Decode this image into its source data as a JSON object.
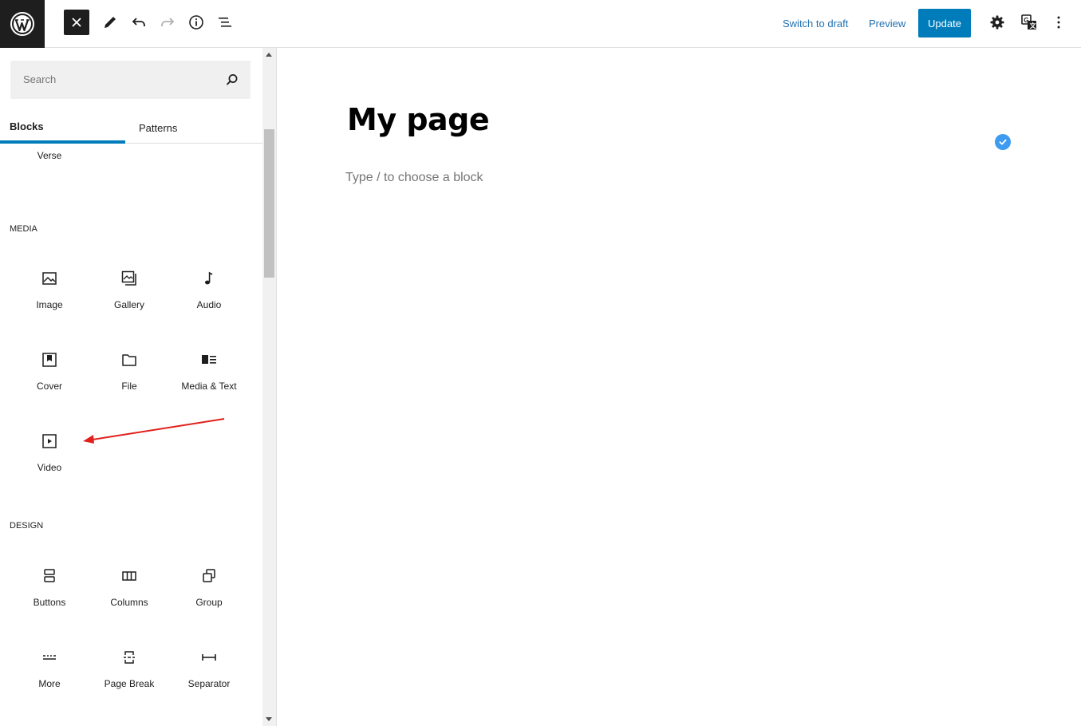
{
  "header": {
    "switch_to_draft": "Switch to draft",
    "preview": "Preview",
    "update": "Update"
  },
  "inserter": {
    "search_placeholder": "Search",
    "tabs": [
      {
        "label": "Blocks",
        "active": true
      },
      {
        "label": "Patterns",
        "active": false
      }
    ],
    "partial_block": {
      "label": "Verse",
      "icon": "verse-icon"
    },
    "sections": [
      {
        "title": "MEDIA",
        "blocks": [
          {
            "label": "Image",
            "icon": "image-icon"
          },
          {
            "label": "Gallery",
            "icon": "gallery-icon"
          },
          {
            "label": "Audio",
            "icon": "audio-icon"
          },
          {
            "label": "Cover",
            "icon": "cover-icon"
          },
          {
            "label": "File",
            "icon": "file-icon"
          },
          {
            "label": "Media & Text",
            "icon": "media-text-icon"
          },
          {
            "label": "Video",
            "icon": "video-icon"
          }
        ]
      },
      {
        "title": "DESIGN",
        "blocks": [
          {
            "label": "Buttons",
            "icon": "buttons-icon"
          },
          {
            "label": "Columns",
            "icon": "columns-icon"
          },
          {
            "label": "Group",
            "icon": "group-icon"
          },
          {
            "label": "More",
            "icon": "more-icon"
          },
          {
            "label": "Page Break",
            "icon": "page-break-icon"
          },
          {
            "label": "Separator",
            "icon": "separator-icon"
          }
        ]
      }
    ]
  },
  "editor": {
    "title": "My page",
    "placeholder": "Type / to choose a block"
  },
  "colors": {
    "accent": "#007cba",
    "link": "#2271b1",
    "annotation_arrow": "#e0201b",
    "check_badge": "#3d9bf0"
  }
}
